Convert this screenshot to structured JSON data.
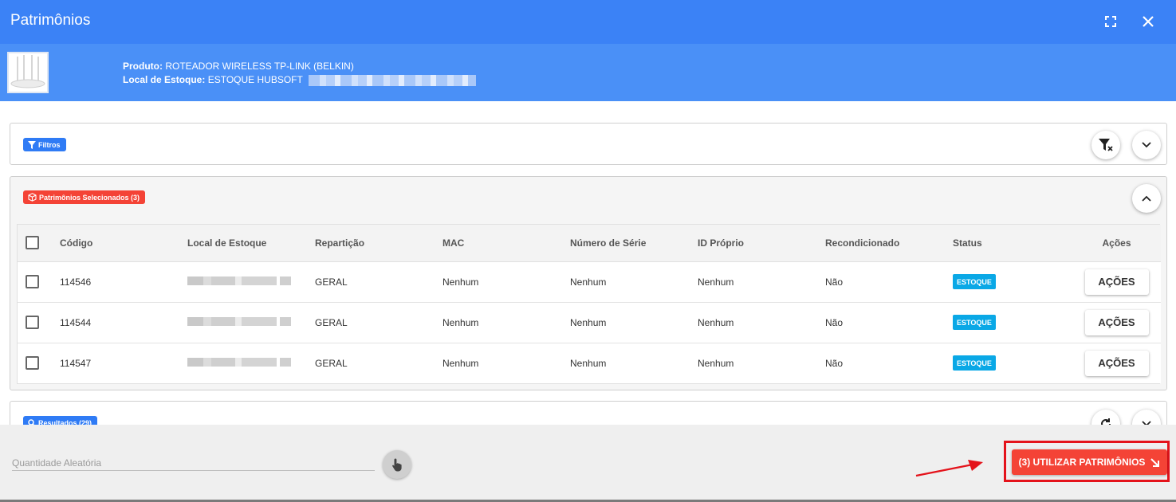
{
  "window": {
    "title": "Patrimônios"
  },
  "product": {
    "produto_label": "Produto:",
    "produto_value": "ROTEADOR WIRELESS TP-LINK (BELKIN)",
    "local_label": "Local de Estoque:",
    "local_value": "ESTOQUE HUBSOFT"
  },
  "filters": {
    "chip_label": "Filtros"
  },
  "selected": {
    "chip_label": "Patrimônios Selecionados (3)",
    "columns": [
      "Código",
      "Local de Estoque",
      "Repartição",
      "MAC",
      "Número de Série",
      "ID Próprio",
      "Recondicionado",
      "Status",
      "Ações"
    ],
    "rows": [
      {
        "codigo": "114546",
        "reparticao": "GERAL",
        "mac": "Nenhum",
        "serie": "Nenhum",
        "id_proprio": "Nenhum",
        "recondicionado": "Não",
        "status": "ESTOQUE",
        "acoes": "AÇÕES"
      },
      {
        "codigo": "114544",
        "reparticao": "GERAL",
        "mac": "Nenhum",
        "serie": "Nenhum",
        "id_proprio": "Nenhum",
        "recondicionado": "Não",
        "status": "ESTOQUE",
        "acoes": "AÇÕES"
      },
      {
        "codigo": "114547",
        "reparticao": "GERAL",
        "mac": "Nenhum",
        "serie": "Nenhum",
        "id_proprio": "Nenhum",
        "recondicionado": "Não",
        "status": "ESTOQUE",
        "acoes": "AÇÕES"
      }
    ]
  },
  "results": {
    "chip_label": "Resultados (29)"
  },
  "footer": {
    "quantity_placeholder": "Quantidade Aleatória",
    "use_button_label": "(3) UTILIZAR PATRIMÔNIOS"
  },
  "colors": {
    "header_blue": "#3b82f6",
    "product_blue": "#4a90f7",
    "accent_red": "#f44336",
    "status_blue": "#0aa8e6",
    "annotation_red": "#e4131b"
  }
}
